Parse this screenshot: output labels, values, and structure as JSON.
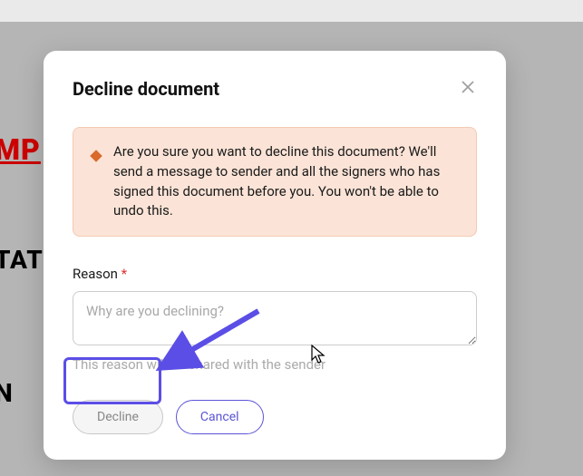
{
  "modal": {
    "title": "Decline document",
    "warning": "Are you sure you want to decline this document? We'll send a message to sender and all the signers who has signed this document before you. You won't be able to undo this.",
    "reason_label": "Reason",
    "required_mark": "*",
    "reason_placeholder": "Why are you declining?",
    "helper_text": "This reason will be shared with the sender",
    "decline_label": "Decline",
    "cancel_label": "Cancel"
  },
  "background": {
    "fragment1": "MP",
    "fragment2": "TAT",
    "fragment3": "N"
  }
}
